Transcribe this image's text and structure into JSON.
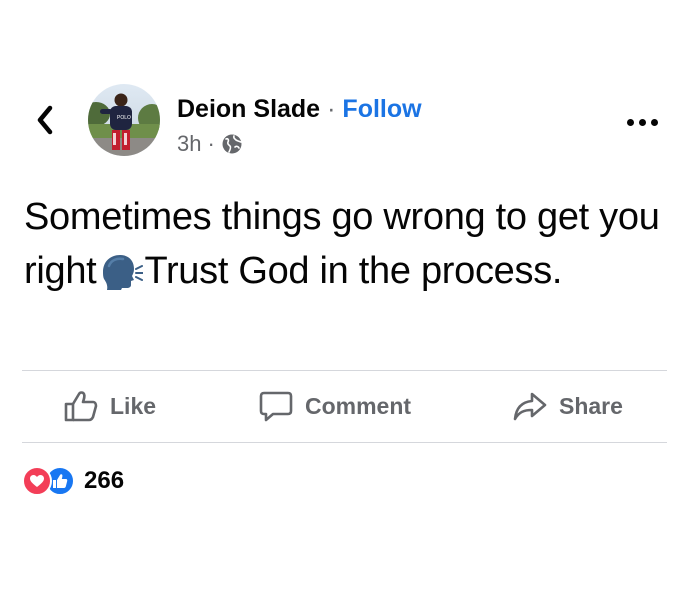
{
  "header": {
    "author_name": "Deion Slade",
    "dot": "·",
    "follow_label": "Follow",
    "time": "3h",
    "time_separator": "·",
    "audience_icon": "globe-icon",
    "back_icon": "chevron-left-icon",
    "more_icon": "more-horizontal-icon"
  },
  "avatar": {
    "shirt_text": "POLO"
  },
  "post": {
    "text_before": "Sometimes things go wrong to get you right",
    "emoji": "speaking-head-icon",
    "text_after": "Trust God in the process."
  },
  "actions": [
    {
      "label": "Like",
      "icon": "thumbs-up-icon"
    },
    {
      "label": "Comment",
      "icon": "comment-bubble-icon"
    },
    {
      "label": "Share",
      "icon": "share-arrow-icon"
    }
  ],
  "reactions": {
    "icons": [
      "love-reaction-icon",
      "like-reaction-icon"
    ],
    "count": "266"
  },
  "colors": {
    "follow_blue": "#1b74e4",
    "like_blue": "#1877f2",
    "love_red": "#f33e58",
    "muted_gray": "#65676b"
  }
}
